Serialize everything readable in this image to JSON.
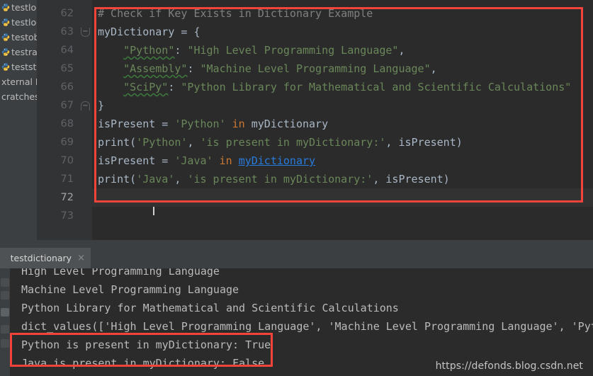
{
  "project_tree": {
    "items": [
      {
        "label": "testlogic",
        "icon": "python-file-icon",
        "has_icon": true
      },
      {
        "label": "testloop",
        "icon": "python-file-icon",
        "has_icon": true
      },
      {
        "label": "testobje",
        "icon": "python-file-icon",
        "has_icon": true
      },
      {
        "label": "testrand",
        "icon": "python-file-icon",
        "has_icon": true
      },
      {
        "label": "teststrin",
        "icon": "python-file-icon",
        "has_icon": true
      },
      {
        "label": "xternal Lib",
        "icon": "none",
        "has_icon": false
      },
      {
        "label": "cratches a",
        "icon": "none",
        "has_icon": false
      }
    ]
  },
  "editor": {
    "current_line": 72,
    "lines": [
      {
        "number": 62,
        "fold": "none",
        "tokens": [
          {
            "t": "# Check if Key Exists in Dictionary Example",
            "c": "cm"
          }
        ]
      },
      {
        "number": 63,
        "fold": "open",
        "tokens": [
          {
            "t": "myDictionary = {",
            "c": "id"
          }
        ]
      },
      {
        "number": 64,
        "fold": "none",
        "tokens": [
          {
            "t": "    ",
            "c": "id"
          },
          {
            "t": "\"Python\"",
            "c": "str wavy"
          },
          {
            "t": ": ",
            "c": "id"
          },
          {
            "t": "\"High Level Programming Language\"",
            "c": "str"
          },
          {
            "t": ",",
            "c": "id"
          }
        ]
      },
      {
        "number": 65,
        "fold": "none",
        "tokens": [
          {
            "t": "    ",
            "c": "id"
          },
          {
            "t": "\"Assembly\"",
            "c": "str wavy"
          },
          {
            "t": ": ",
            "c": "id"
          },
          {
            "t": "\"Machine Level Programming Language\"",
            "c": "str"
          },
          {
            "t": ",",
            "c": "id"
          }
        ]
      },
      {
        "number": 66,
        "fold": "none",
        "tokens": [
          {
            "t": "    ",
            "c": "id"
          },
          {
            "t": "\"SciPy\"",
            "c": "str wavy"
          },
          {
            "t": ": ",
            "c": "id"
          },
          {
            "t": "\"Python Library for Mathematical and Scientific Calculations\"",
            "c": "str"
          }
        ]
      },
      {
        "number": 67,
        "fold": "close",
        "tokens": [
          {
            "t": "}",
            "c": "id"
          }
        ]
      },
      {
        "number": 68,
        "fold": "none",
        "tokens": [
          {
            "t": "isPresent = ",
            "c": "id"
          },
          {
            "t": "'Python'",
            "c": "str"
          },
          {
            "t": " ",
            "c": "id"
          },
          {
            "t": "in",
            "c": "kw"
          },
          {
            "t": " myDictionary",
            "c": "id"
          }
        ]
      },
      {
        "number": 69,
        "fold": "none",
        "tokens": [
          {
            "t": "print(",
            "c": "id"
          },
          {
            "t": "'Python'",
            "c": "str"
          },
          {
            "t": ", ",
            "c": "id"
          },
          {
            "t": "'is present in myDictionary:'",
            "c": "str"
          },
          {
            "t": ", isPresent)",
            "c": "id"
          }
        ]
      },
      {
        "number": 70,
        "fold": "none",
        "tokens": [
          {
            "t": "isPresent = ",
            "c": "id"
          },
          {
            "t": "'Java'",
            "c": "str"
          },
          {
            "t": " ",
            "c": "id"
          },
          {
            "t": "in",
            "c": "kw"
          },
          {
            "t": " ",
            "c": "id"
          },
          {
            "t": "myDictionary",
            "c": "errlink"
          }
        ]
      },
      {
        "number": 71,
        "fold": "none",
        "tokens": [
          {
            "t": "print(",
            "c": "id"
          },
          {
            "t": "'Java'",
            "c": "str"
          },
          {
            "t": ", ",
            "c": "id"
          },
          {
            "t": "'is present in myDictionary:'",
            "c": "str"
          },
          {
            "t": ", isPresent)",
            "c": "id"
          }
        ]
      },
      {
        "number": 72,
        "fold": "none",
        "tokens": []
      },
      {
        "number": 73,
        "fold": "none",
        "tokens": []
      }
    ]
  },
  "console": {
    "tab_label": "testdictionary",
    "tab_close_glyph": "×",
    "tab_icon": "python-file-icon",
    "output_lines": [
      "High Level Programming Language",
      "Machine Level Programming Language",
      "Python Library for Mathematical and Scientific Calculations",
      "dict_values(['High Level Programming Language', 'Machine Level Programming Language', 'Pyt",
      "Python is present in myDictionary: True",
      "Java is present in myDictionary: False"
    ]
  },
  "watermark": "https://defonds.blog.csdn.net",
  "annotations": {
    "code_box_color": "#f4433a",
    "output_box_color": "#f4433a"
  }
}
